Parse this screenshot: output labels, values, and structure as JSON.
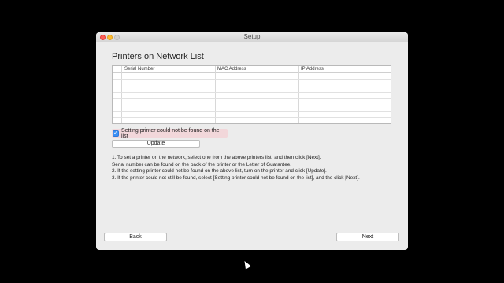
{
  "window": {
    "title": "Setup"
  },
  "page": {
    "heading": "Printers on Network List"
  },
  "table": {
    "columns": [
      "Serial Number",
      "MAC Address",
      "IP Address"
    ],
    "rows": []
  },
  "not_found": {
    "label": "Setting printer could not be found on the list",
    "checked": true
  },
  "buttons": {
    "update": "Update",
    "back": "Back",
    "next": "Next"
  },
  "instructions": [
    "1. To set a printer on the network, select one from the above printers list, and then click [Next].",
    "Serial number can be found on the back of the printer or the Letter of Guarantee.",
    "2. If the setting printer could not be found on the above list, turn on the printer and click [Update].",
    "3. If the printer could not still be found, select [Setting printer could not be found on the list], and the click [Next]."
  ],
  "colors": {
    "accent": "#3b8ff5",
    "highlight": "#f2d7da"
  }
}
